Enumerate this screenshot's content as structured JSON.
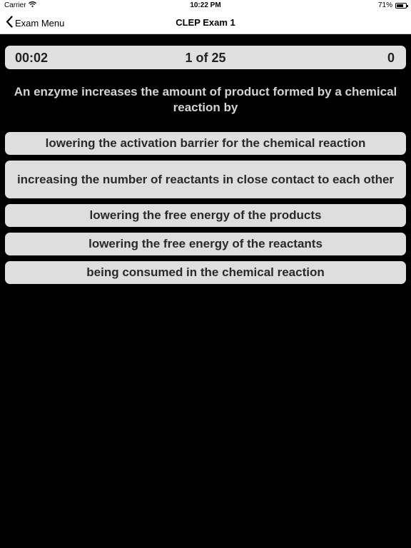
{
  "status_bar": {
    "carrier": "Carrier",
    "time": "10:22 PM",
    "battery": "71%",
    "battery_level": 0.71,
    "wifi_icon": "wifi-icon",
    "battery_icon": "battery-icon"
  },
  "nav": {
    "back_label": "Exam Menu",
    "back_icon": "chevron-left-icon",
    "title": "CLEP Exam 1"
  },
  "exam": {
    "timer": "00:02",
    "progress": "1 of 25",
    "score": "0"
  },
  "question": {
    "text": "An enzyme increases the amount of product formed by a chemical reaction by",
    "answers": [
      "lowering the activation barrier for the chemical reaction",
      "increasing the number of reactants in close contact to each other",
      "lowering the free energy of the products",
      "lowering the free energy of the reactants",
      "being consumed in the chemical reaction"
    ]
  },
  "colors": {
    "background": "#000000",
    "bar": "#ffffff",
    "card": "#dedede",
    "question_text": "#d4d4d4"
  }
}
